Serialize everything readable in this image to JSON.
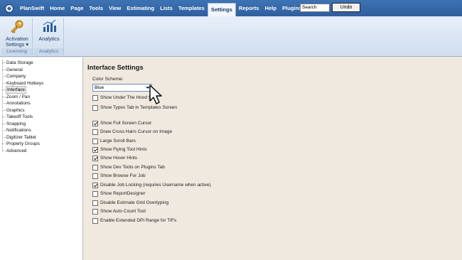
{
  "menubar": {
    "app_name": "PlanSwift",
    "items": [
      "Home",
      "Page",
      "Tools",
      "View",
      "Estimating",
      "Lists",
      "Templates",
      "Settings",
      "Reports",
      "Help",
      "Plugins"
    ],
    "active": "Settings",
    "search_value": "Search",
    "undo_label": "Undo"
  },
  "ribbon": {
    "groups": [
      {
        "label": "Licensing",
        "button": "Activation Settings",
        "button_line1": "Activation",
        "button_line2": "Settings",
        "icon": "key-icon"
      },
      {
        "label": "Analytics",
        "button": "Analytics",
        "icon": "bar-chart-icon"
      }
    ]
  },
  "tree": {
    "items": [
      "Data Storage",
      "General",
      "Company",
      "Keyboard Hotkeys",
      "Interface",
      "Zoom / Pan",
      "Annotations",
      "Graphics",
      "Takeoff Tools",
      "Snapping",
      "Notifications",
      "Digitizer Tablet",
      "Property Groups",
      "Advanced"
    ],
    "selected": "Interface"
  },
  "panel": {
    "title": "Interface Settings",
    "color_scheme_label": "Color Scheme:",
    "color_scheme_value": "Blue",
    "options": [
      {
        "label": "Show Under The Hood S",
        "checked": false
      },
      {
        "label": "Show Types Tab in Templates Screen",
        "checked": false
      },
      {
        "label": "Show Full Screen Cursor",
        "checked": true
      },
      {
        "label": "Draw Cross Hairs Cursor on Image",
        "checked": false
      },
      {
        "label": "Large Scroll Bars",
        "checked": false
      },
      {
        "label": "Show Flying Tool Hints",
        "checked": true
      },
      {
        "label": "Show Hover Hints",
        "checked": true
      },
      {
        "label": "Show Dev Tools on Plugins Tab",
        "checked": false
      },
      {
        "label": "Show Browse For Job",
        "checked": false
      },
      {
        "label": "Disable Job Locking (requires Username when active)",
        "checked": true
      },
      {
        "label": "Show ReportDesigner",
        "checked": false
      },
      {
        "label": "Disable Estimate Grid Overtyping",
        "checked": false
      },
      {
        "label": "Show Auto Count Tool",
        "checked": false
      },
      {
        "label": "Enable Extended DPI Range for TIFs",
        "checked": false
      }
    ]
  },
  "colors": {
    "menubar": "#2f5e9d",
    "ribbon": "#d0deef",
    "panel_bg": "#efe9df"
  }
}
